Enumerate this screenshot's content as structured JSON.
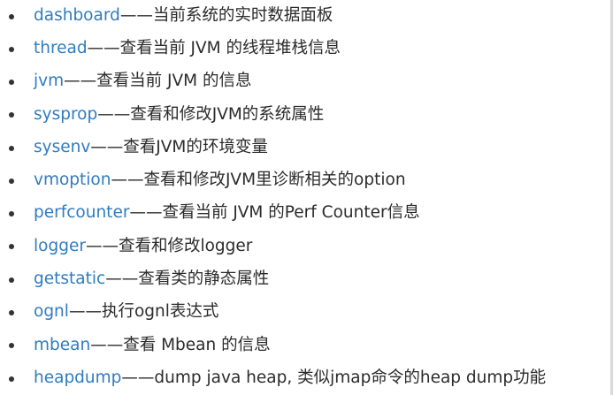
{
  "colors": {
    "link": "#2f7cc0",
    "text": "#2b2b2b",
    "bullet": "#333333"
  },
  "items": [
    {
      "command": "dashboard",
      "description": "——当前系统的实时数据面板"
    },
    {
      "command": "thread",
      "description": "——查看当前 JVM 的线程堆栈信息"
    },
    {
      "command": "jvm",
      "description": "——查看当前 JVM 的信息"
    },
    {
      "command": "sysprop",
      "description": "——查看和修改JVM的系统属性"
    },
    {
      "command": "sysenv",
      "description": "——查看JVM的环境变量"
    },
    {
      "command": "vmoption",
      "description": "——查看和修改JVM里诊断相关的option"
    },
    {
      "command": "perfcounter",
      "description": "——查看当前 JVM 的Perf Counter信息"
    },
    {
      "command": "logger",
      "description": "——查看和修改logger"
    },
    {
      "command": "getstatic",
      "description": "——查看类的静态属性"
    },
    {
      "command": "ognl",
      "description": "——执行ognl表达式"
    },
    {
      "command": "mbean",
      "description": "——查看 Mbean 的信息"
    },
    {
      "command": "heapdump",
      "description": "——dump java heap, 类似jmap命令的heap dump功能"
    }
  ]
}
